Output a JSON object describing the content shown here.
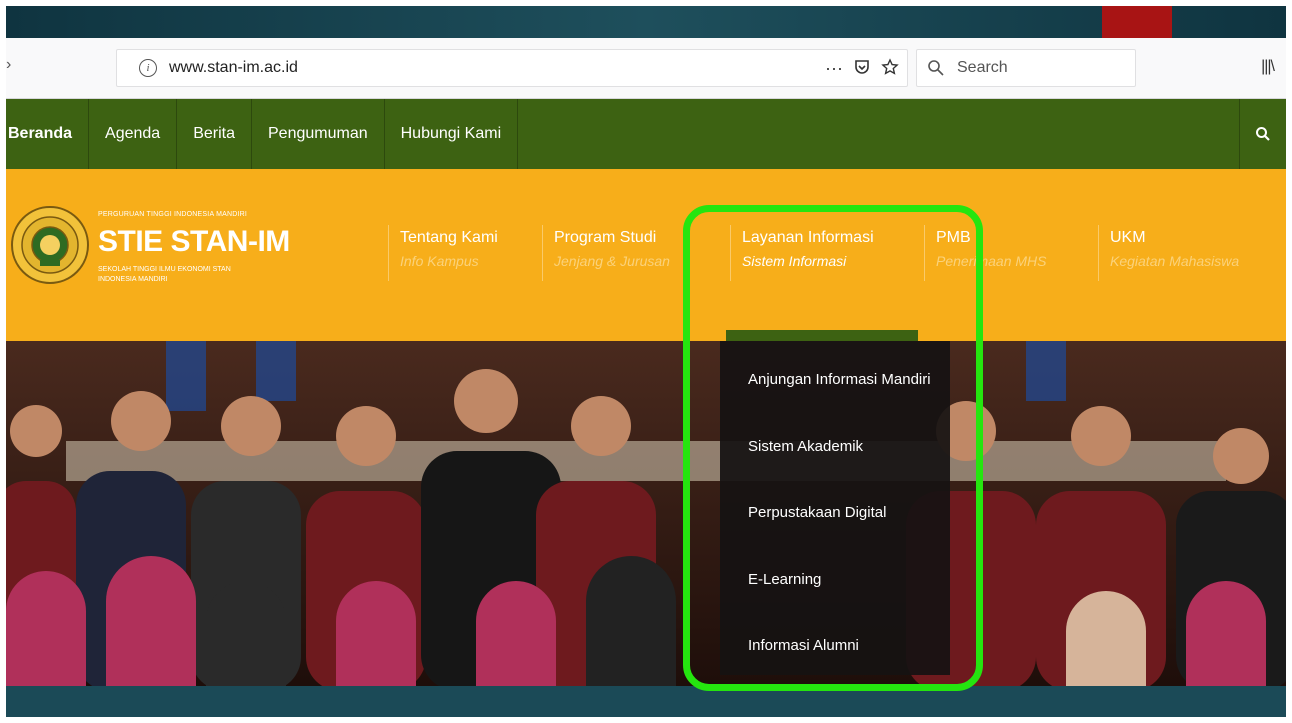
{
  "browser": {
    "url": "www.stan-im.ac.id",
    "page_actions_icon": "more-icon",
    "search_placeholder": "Search"
  },
  "topnav": {
    "items": [
      "Beranda",
      "Agenda",
      "Berita",
      "Pengumuman",
      "Hubungi Kami"
    ]
  },
  "brand": {
    "small_top": "PERGURUAN TINGGI INDONESIA MANDIRI",
    "title": "STIE STAN-IM",
    "subtitle": "SEKOLAH TINGGI ILMU EKONOMI STAN INDONESIA MANDIRI"
  },
  "main_menu": [
    {
      "title": "Tentang Kami",
      "subtitle": "Info Kampus"
    },
    {
      "title": "Program Studi",
      "subtitle": "Jenjang & Jurusan"
    },
    {
      "title": "Layanan Informasi",
      "subtitle": "Sistem Informasi"
    },
    {
      "title": "PMB",
      "subtitle": "Penerimaan MHS"
    },
    {
      "title": "UKM",
      "subtitle": "Kegiatan Mahasiswa"
    }
  ],
  "dropdown": {
    "items": [
      "Anjungan Informasi Mandiri",
      "Sistem Akademik",
      "Perpustakaan Digital",
      "E-Learning",
      "Informasi Alumni"
    ]
  },
  "colors": {
    "nav_green": "#3d6212",
    "header_yellow": "#f7ae1a",
    "highlight_green": "#25e50f",
    "slide_bg": "#1e4f5c",
    "slide_accent": "#a81414"
  }
}
